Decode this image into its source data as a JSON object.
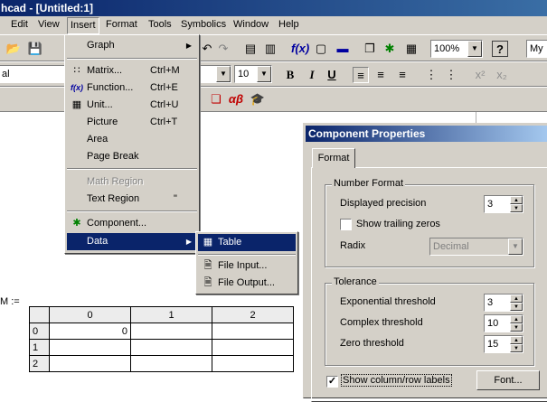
{
  "window": {
    "title": "hcad - [Untitled:1]"
  },
  "menubar": [
    "Edit",
    "View",
    "Insert",
    "Format",
    "Tools",
    "Symbolics",
    "Window",
    "Help"
  ],
  "toolbar": {
    "zoom": "100%",
    "font_combo": "My",
    "style_combo": "al",
    "font_size": "10"
  },
  "insert_menu": {
    "graph": "Graph",
    "matrix": "Matrix...",
    "matrix_sc": "Ctrl+M",
    "function": "Function...",
    "function_sc": "Ctrl+E",
    "unit": "Unit...",
    "unit_sc": "Ctrl+U",
    "picture": "Picture",
    "picture_sc": "Ctrl+T",
    "area": "Area",
    "page_break": "Page Break",
    "math_region": "Math Region",
    "text_region": "Text Region",
    "text_region_sc": "\"",
    "component": "Component...",
    "data": "Data"
  },
  "data_submenu": {
    "table": "Table",
    "file_input": "File Input...",
    "file_output": "File Output..."
  },
  "dialog": {
    "title": "Component Properties",
    "tab": "Format",
    "number_format": "Number Format",
    "displayed_precision": "Displayed precision",
    "displayed_precision_value": "3",
    "show_trailing_zeros": "Show trailing zeros",
    "radix": "Radix",
    "radix_value": "Decimal",
    "tolerance": "Tolerance",
    "exp_threshold": "Exponential threshold",
    "exp_threshold_value": "3",
    "complex_threshold": "Complex threshold",
    "complex_threshold_value": "10",
    "zero_threshold": "Zero threshold",
    "zero_threshold_value": "15",
    "show_labels": "Show column/row labels",
    "font_button": "Font..."
  },
  "matrix": {
    "name": "M :=",
    "col_headers": [
      "0",
      "1",
      "2"
    ],
    "rows": [
      {
        "label": "0",
        "cells": [
          "0",
          "",
          ""
        ]
      },
      {
        "label": "1",
        "cells": [
          "",
          "",
          ""
        ]
      },
      {
        "label": "2",
        "cells": [
          "",
          "",
          ""
        ]
      }
    ]
  }
}
